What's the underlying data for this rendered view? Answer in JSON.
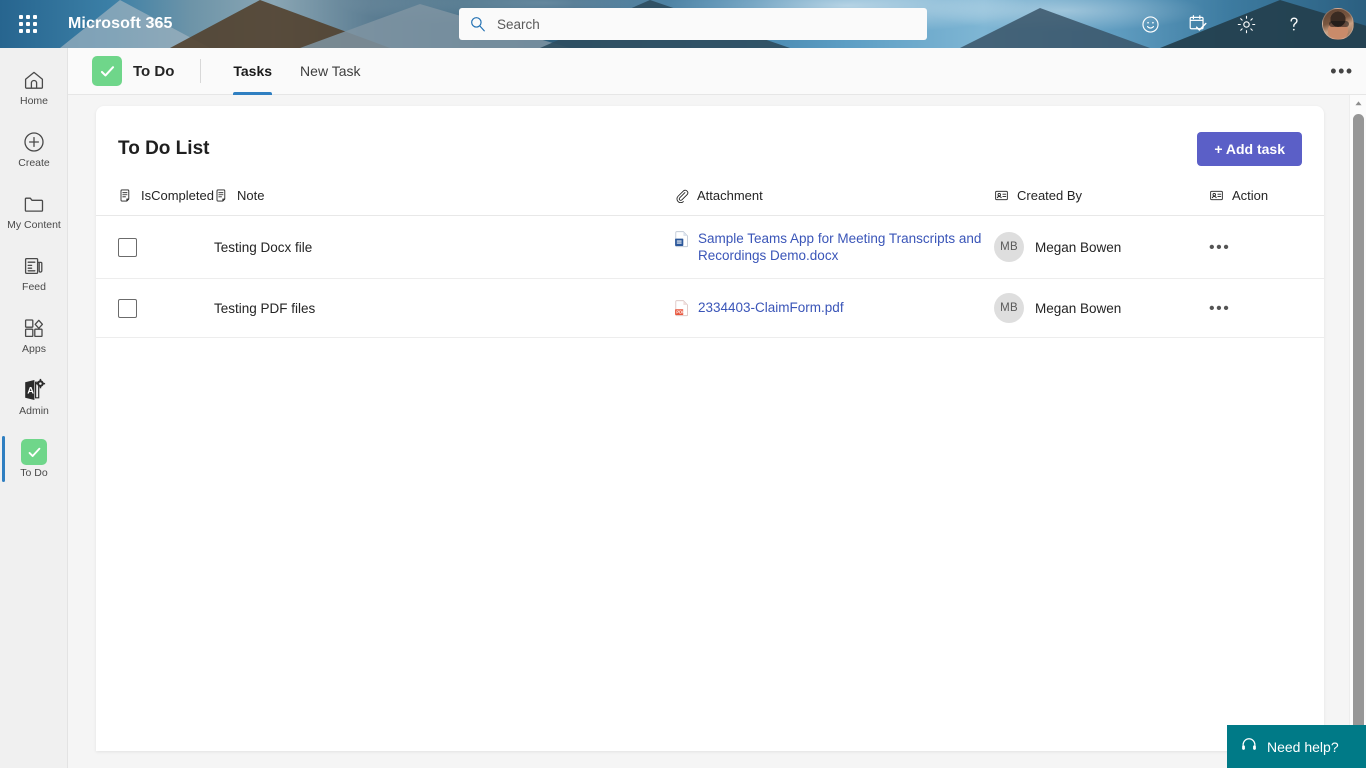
{
  "header": {
    "waffle_label": "app-launcher",
    "brand": "Microsoft 365",
    "search": {
      "placeholder": "Search",
      "value": ""
    },
    "actions": [
      {
        "name": "feedback-icon",
        "label": "Feedback"
      },
      {
        "name": "tasks-icon",
        "label": "Tasks"
      },
      {
        "name": "gear-icon",
        "label": "Settings"
      },
      {
        "name": "help-icon",
        "label": "?"
      }
    ],
    "avatar_alt": "Account manager"
  },
  "rail": {
    "items": [
      {
        "label": "Home",
        "icon": "home-icon",
        "selected": false
      },
      {
        "label": "Create",
        "icon": "plus-circle-icon",
        "selected": false
      },
      {
        "label": "My Content",
        "icon": "folder-icon",
        "selected": false
      },
      {
        "label": "Feed",
        "icon": "feed-icon",
        "selected": false
      },
      {
        "label": "Apps",
        "icon": "apps-icon",
        "selected": false
      },
      {
        "label": "Admin",
        "icon": "admin-icon",
        "selected": false
      },
      {
        "label": "To Do",
        "icon": "todo-check-icon",
        "selected": true
      }
    ]
  },
  "appbar": {
    "app_name": "To Do",
    "app_icon": "todo-check-icon",
    "tabs": [
      {
        "label": "Tasks",
        "active": true
      },
      {
        "label": "New Task",
        "active": false
      }
    ],
    "more_label": "•••"
  },
  "card": {
    "title": "To Do List",
    "add_task_label": "+ Add task",
    "columns": [
      {
        "label": "IsCompleted",
        "icon": "note-icon"
      },
      {
        "label": "Note",
        "icon": "note-icon"
      },
      {
        "label": "Attachment",
        "icon": "paperclip-icon"
      },
      {
        "label": "Created By",
        "icon": "contact-card-icon"
      },
      {
        "label": "Action",
        "icon": "contact-card-icon"
      }
    ],
    "rows": [
      {
        "completed": false,
        "note": "Testing Docx file",
        "attachment": "Sample Teams App for Meeting Transcripts and Recordings Demo.docx",
        "attachment_type": "docx",
        "created_by": "Megan Bowen",
        "created_by_initials": "MB",
        "action_label": "•••"
      },
      {
        "completed": false,
        "note": "Testing PDF files",
        "attachment": "2334403-ClaimForm.pdf",
        "attachment_type": "pdf",
        "created_by": "Megan Bowen",
        "created_by_initials": "MB",
        "action_label": "•••"
      }
    ]
  },
  "need_help": {
    "label": "Need help?",
    "icon": "headset-icon"
  },
  "colors": {
    "accent_purple": "#5b5fc7",
    "todo_green": "#6fd68a",
    "tab_blue": "#2f7fc1",
    "link_blue": "#3a55b8",
    "help_teal": "#007a87",
    "header_blue": "#1b6ea8"
  }
}
